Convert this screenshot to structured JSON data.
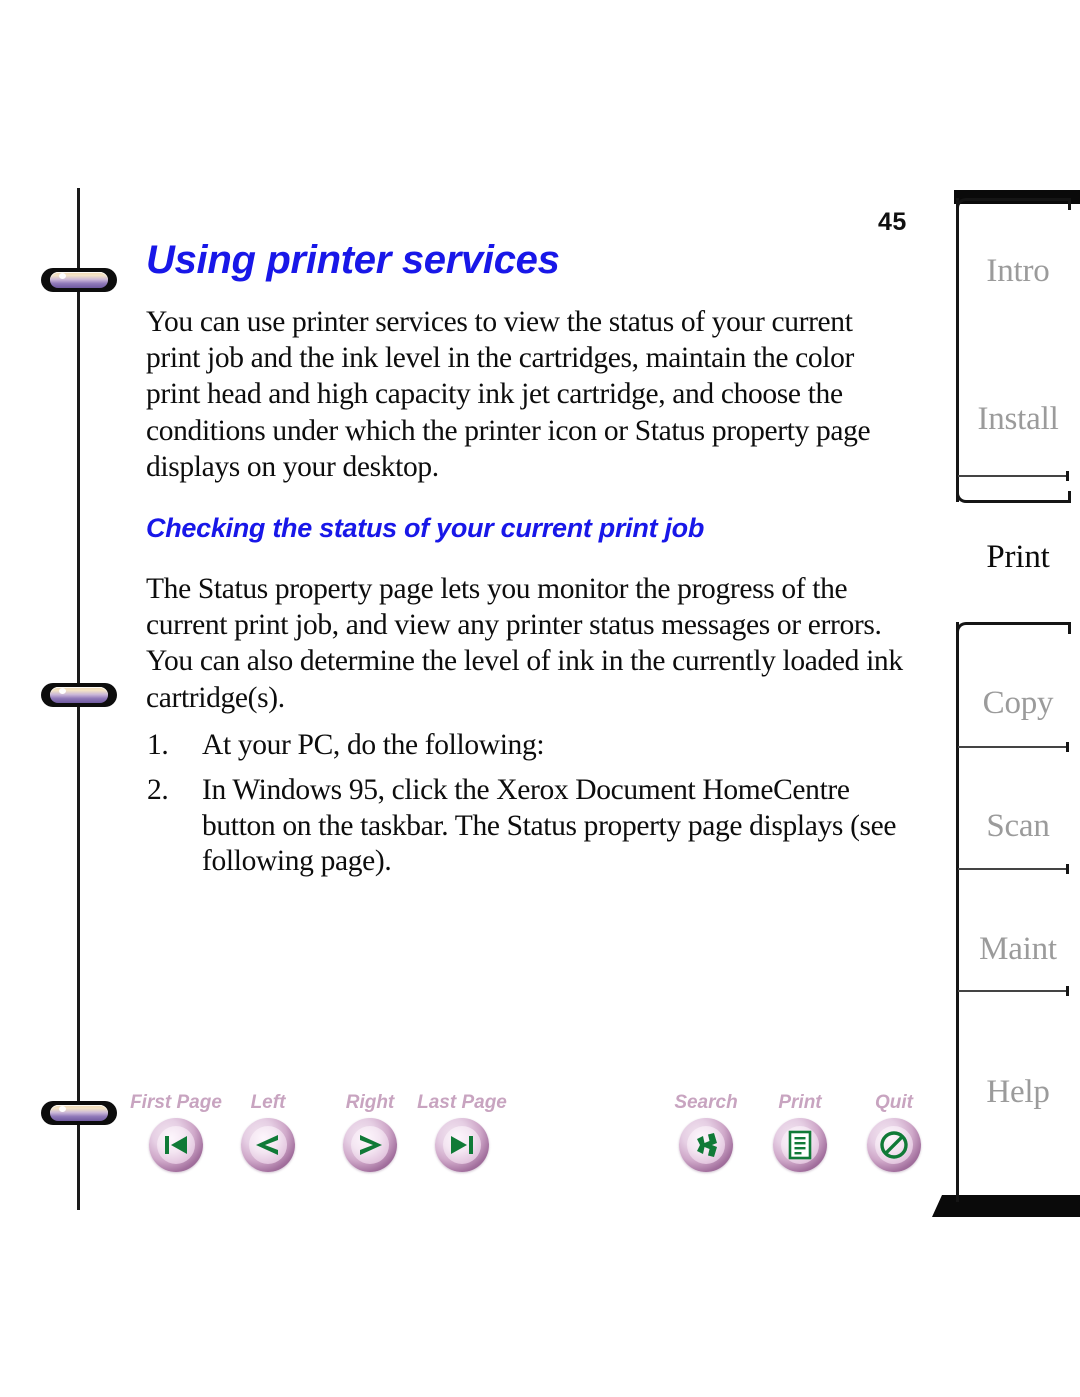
{
  "document": {
    "page_number": "45",
    "title": "Using printer services",
    "intro_paragraph": "You can use printer services to view the status of your current print job and the ink level in the cartridges, maintain the color print head and high capacity ink jet cartridge, and choose the conditions under which the printer icon or Status property page displays on your desktop.",
    "subtitle": "Checking the status of your current print job",
    "status_paragraph": "The Status property page lets you monitor the progress of the current print job, and view any printer status messages or errors. You can also determine the level of ink in the currently loaded ink cartridge(s).",
    "steps": [
      {
        "number": "1.",
        "text": "At your PC, do the following:"
      },
      {
        "number": "2.",
        "text": "In Windows 95, click the Xerox Document HomeCentre button on the taskbar. The Status property page displays (see following page)."
      }
    ]
  },
  "toolbar": {
    "navigation": [
      {
        "label": "First Page",
        "icon": "first-page-icon"
      },
      {
        "label": "Left",
        "icon": "previous-page-icon"
      },
      {
        "label": "Right",
        "icon": "next-page-icon"
      },
      {
        "label": "Last Page",
        "icon": "last-page-icon"
      }
    ],
    "tools": [
      {
        "label": "Search",
        "icon": "search-icon"
      },
      {
        "label": "Print",
        "icon": "print-icon"
      },
      {
        "label": "Quit",
        "icon": "quit-icon"
      }
    ]
  },
  "tab_rail": {
    "tabs": [
      {
        "label": "Intro",
        "active": false
      },
      {
        "label": "Install",
        "active": false
      },
      {
        "label": "Print",
        "active": true
      },
      {
        "label": "Copy",
        "active": false
      },
      {
        "label": "Scan",
        "active": false
      },
      {
        "label": "Maint",
        "active": false
      },
      {
        "label": "Help",
        "active": false
      }
    ]
  },
  "colors": {
    "heading_blue": "#1817e8",
    "tab_inactive": "#9b9b9b",
    "tab_active": "#0b0b0b",
    "button_label_mauve": "#c8a4c0",
    "button_glyph_green": "#107a37",
    "ink_black": "#0d0d0d"
  }
}
